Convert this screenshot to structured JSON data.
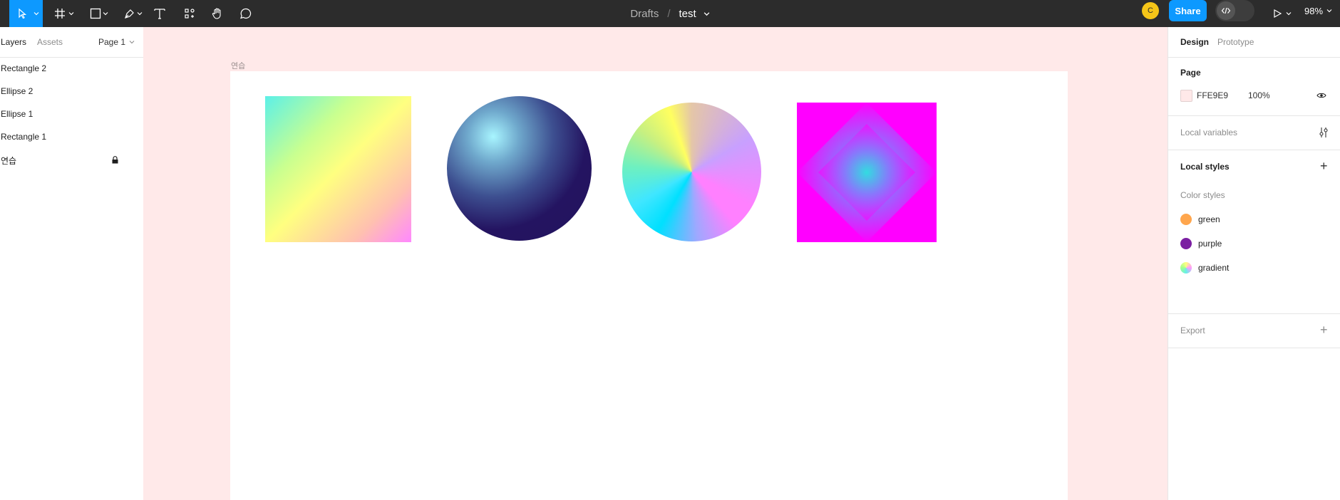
{
  "toolbar": {
    "breadcrumb": "Drafts",
    "separator": "/",
    "file_name": "test",
    "avatar_initial": "C",
    "share_label": "Share",
    "zoom": "98%"
  },
  "left_panel": {
    "tabs": [
      {
        "label": "Layers"
      },
      {
        "label": "Assets"
      }
    ],
    "page_selector": "Page 1",
    "layers": [
      {
        "label": "Rectangle 2"
      },
      {
        "label": "Ellipse 2"
      },
      {
        "label": "Ellipse 1"
      },
      {
        "label": "Rectangle 1"
      },
      {
        "label": "연습"
      }
    ]
  },
  "canvas": {
    "background": "#FFE9E9",
    "frame_label": "연습"
  },
  "right_panel": {
    "tabs": [
      {
        "label": "Design"
      },
      {
        "label": "Prototype"
      }
    ],
    "page_heading": "Page",
    "page_color_hex": "FFE9E9",
    "page_opacity": "100%",
    "local_variables": "Local variables",
    "local_styles": "Local styles",
    "color_styles_heading": "Color styles",
    "color_styles": [
      {
        "name": "green",
        "color": "#FFA64D"
      },
      {
        "name": "purple",
        "color": "#7B1FA2"
      },
      {
        "name": "gradient",
        "color": "gradient"
      }
    ],
    "export": "Export"
  }
}
